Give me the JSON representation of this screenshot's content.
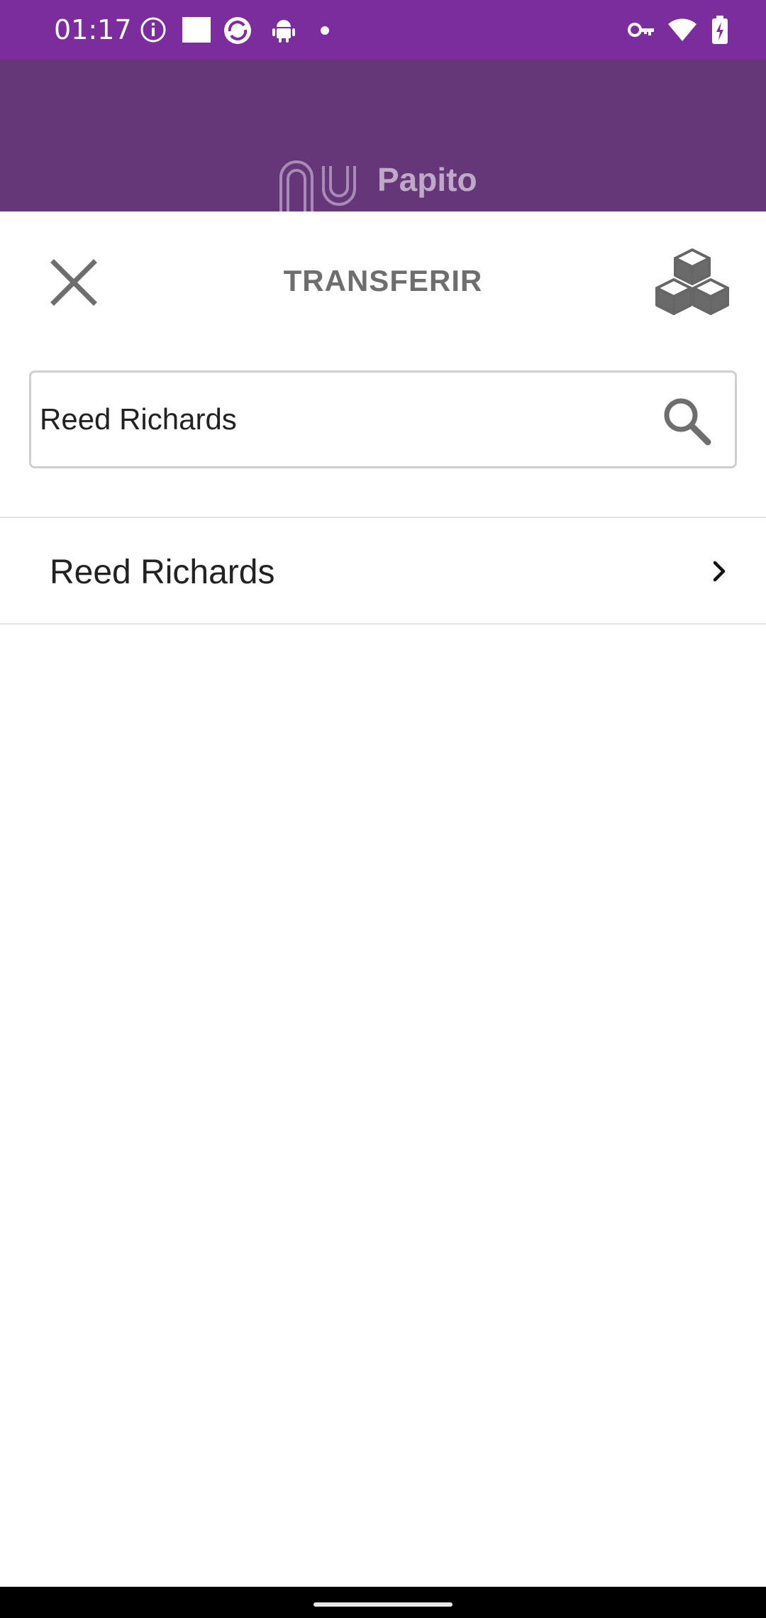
{
  "status_bar": {
    "time": "01:17",
    "left_icons": [
      "info-icon",
      "square-notification-icon",
      "sync-app-icon",
      "android-icon",
      "dot-icon"
    ],
    "right_icons": [
      "vpn-key-icon",
      "wifi-icon",
      "battery-charging-icon"
    ]
  },
  "header": {
    "brand_name": "Papito"
  },
  "sheet": {
    "title": "TRANSFERIR"
  },
  "search": {
    "value": "Reed Richards"
  },
  "results": [
    {
      "label": "Reed Richards"
    }
  ],
  "colors": {
    "status_bar": "#7b2d9e",
    "header": "#663778",
    "title_text": "#6e6e6e"
  }
}
